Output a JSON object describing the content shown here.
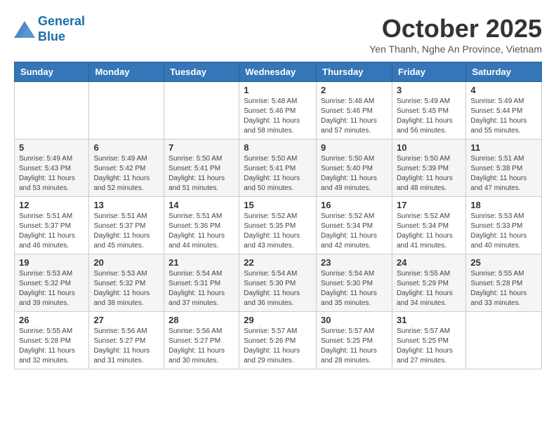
{
  "header": {
    "logo_line1": "General",
    "logo_line2": "Blue",
    "month": "October 2025",
    "location": "Yen Thanh, Nghe An Province, Vietnam"
  },
  "weekdays": [
    "Sunday",
    "Monday",
    "Tuesday",
    "Wednesday",
    "Thursday",
    "Friday",
    "Saturday"
  ],
  "rows": [
    [
      {
        "day": "",
        "sunrise": "",
        "sunset": "",
        "daylight": ""
      },
      {
        "day": "",
        "sunrise": "",
        "sunset": "",
        "daylight": ""
      },
      {
        "day": "",
        "sunrise": "",
        "sunset": "",
        "daylight": ""
      },
      {
        "day": "1",
        "sunrise": "Sunrise: 5:48 AM",
        "sunset": "Sunset: 5:46 PM",
        "daylight": "Daylight: 11 hours and 58 minutes."
      },
      {
        "day": "2",
        "sunrise": "Sunrise: 5:48 AM",
        "sunset": "Sunset: 5:46 PM",
        "daylight": "Daylight: 11 hours and 57 minutes."
      },
      {
        "day": "3",
        "sunrise": "Sunrise: 5:49 AM",
        "sunset": "Sunset: 5:45 PM",
        "daylight": "Daylight: 11 hours and 56 minutes."
      },
      {
        "day": "4",
        "sunrise": "Sunrise: 5:49 AM",
        "sunset": "Sunset: 5:44 PM",
        "daylight": "Daylight: 11 hours and 55 minutes."
      }
    ],
    [
      {
        "day": "5",
        "sunrise": "Sunrise: 5:49 AM",
        "sunset": "Sunset: 5:43 PM",
        "daylight": "Daylight: 11 hours and 53 minutes."
      },
      {
        "day": "6",
        "sunrise": "Sunrise: 5:49 AM",
        "sunset": "Sunset: 5:42 PM",
        "daylight": "Daylight: 11 hours and 52 minutes."
      },
      {
        "day": "7",
        "sunrise": "Sunrise: 5:50 AM",
        "sunset": "Sunset: 5:41 PM",
        "daylight": "Daylight: 11 hours and 51 minutes."
      },
      {
        "day": "8",
        "sunrise": "Sunrise: 5:50 AM",
        "sunset": "Sunset: 5:41 PM",
        "daylight": "Daylight: 11 hours and 50 minutes."
      },
      {
        "day": "9",
        "sunrise": "Sunrise: 5:50 AM",
        "sunset": "Sunset: 5:40 PM",
        "daylight": "Daylight: 11 hours and 49 minutes."
      },
      {
        "day": "10",
        "sunrise": "Sunrise: 5:50 AM",
        "sunset": "Sunset: 5:39 PM",
        "daylight": "Daylight: 11 hours and 48 minutes."
      },
      {
        "day": "11",
        "sunrise": "Sunrise: 5:51 AM",
        "sunset": "Sunset: 5:38 PM",
        "daylight": "Daylight: 11 hours and 47 minutes."
      }
    ],
    [
      {
        "day": "12",
        "sunrise": "Sunrise: 5:51 AM",
        "sunset": "Sunset: 5:37 PM",
        "daylight": "Daylight: 11 hours and 46 minutes."
      },
      {
        "day": "13",
        "sunrise": "Sunrise: 5:51 AM",
        "sunset": "Sunset: 5:37 PM",
        "daylight": "Daylight: 11 hours and 45 minutes."
      },
      {
        "day": "14",
        "sunrise": "Sunrise: 5:51 AM",
        "sunset": "Sunset: 5:36 PM",
        "daylight": "Daylight: 11 hours and 44 minutes."
      },
      {
        "day": "15",
        "sunrise": "Sunrise: 5:52 AM",
        "sunset": "Sunset: 5:35 PM",
        "daylight": "Daylight: 11 hours and 43 minutes."
      },
      {
        "day": "16",
        "sunrise": "Sunrise: 5:52 AM",
        "sunset": "Sunset: 5:34 PM",
        "daylight": "Daylight: 11 hours and 42 minutes."
      },
      {
        "day": "17",
        "sunrise": "Sunrise: 5:52 AM",
        "sunset": "Sunset: 5:34 PM",
        "daylight": "Daylight: 11 hours and 41 minutes."
      },
      {
        "day": "18",
        "sunrise": "Sunrise: 5:53 AM",
        "sunset": "Sunset: 5:33 PM",
        "daylight": "Daylight: 11 hours and 40 minutes."
      }
    ],
    [
      {
        "day": "19",
        "sunrise": "Sunrise: 5:53 AM",
        "sunset": "Sunset: 5:32 PM",
        "daylight": "Daylight: 11 hours and 39 minutes."
      },
      {
        "day": "20",
        "sunrise": "Sunrise: 5:53 AM",
        "sunset": "Sunset: 5:32 PM",
        "daylight": "Daylight: 11 hours and 38 minutes."
      },
      {
        "day": "21",
        "sunrise": "Sunrise: 5:54 AM",
        "sunset": "Sunset: 5:31 PM",
        "daylight": "Daylight: 11 hours and 37 minutes."
      },
      {
        "day": "22",
        "sunrise": "Sunrise: 5:54 AM",
        "sunset": "Sunset: 5:30 PM",
        "daylight": "Daylight: 11 hours and 36 minutes."
      },
      {
        "day": "23",
        "sunrise": "Sunrise: 5:54 AM",
        "sunset": "Sunset: 5:30 PM",
        "daylight": "Daylight: 11 hours and 35 minutes."
      },
      {
        "day": "24",
        "sunrise": "Sunrise: 5:55 AM",
        "sunset": "Sunset: 5:29 PM",
        "daylight": "Daylight: 11 hours and 34 minutes."
      },
      {
        "day": "25",
        "sunrise": "Sunrise: 5:55 AM",
        "sunset": "Sunset: 5:28 PM",
        "daylight": "Daylight: 11 hours and 33 minutes."
      }
    ],
    [
      {
        "day": "26",
        "sunrise": "Sunrise: 5:55 AM",
        "sunset": "Sunset: 5:28 PM",
        "daylight": "Daylight: 11 hours and 32 minutes."
      },
      {
        "day": "27",
        "sunrise": "Sunrise: 5:56 AM",
        "sunset": "Sunset: 5:27 PM",
        "daylight": "Daylight: 11 hours and 31 minutes."
      },
      {
        "day": "28",
        "sunrise": "Sunrise: 5:56 AM",
        "sunset": "Sunset: 5:27 PM",
        "daylight": "Daylight: 11 hours and 30 minutes."
      },
      {
        "day": "29",
        "sunrise": "Sunrise: 5:57 AM",
        "sunset": "Sunset: 5:26 PM",
        "daylight": "Daylight: 11 hours and 29 minutes."
      },
      {
        "day": "30",
        "sunrise": "Sunrise: 5:57 AM",
        "sunset": "Sunset: 5:25 PM",
        "daylight": "Daylight: 11 hours and 28 minutes."
      },
      {
        "day": "31",
        "sunrise": "Sunrise: 5:57 AM",
        "sunset": "Sunset: 5:25 PM",
        "daylight": "Daylight: 11 hours and 27 minutes."
      },
      {
        "day": "",
        "sunrise": "",
        "sunset": "",
        "daylight": ""
      }
    ]
  ]
}
